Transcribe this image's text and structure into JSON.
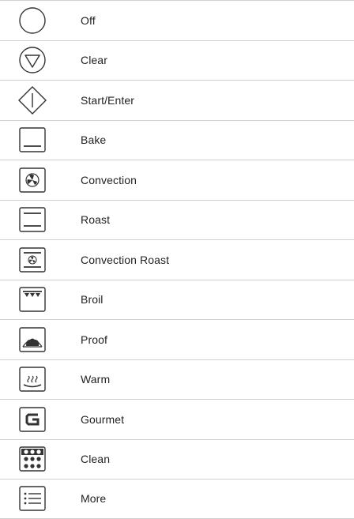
{
  "rows": [
    {
      "label": "Off",
      "icon": "off-circle-icon"
    },
    {
      "label": "Clear",
      "icon": "clear-triangle-icon"
    },
    {
      "label": "Start/Enter",
      "icon": "start-diamond-icon"
    },
    {
      "label": "Bake",
      "icon": "bake-icon"
    },
    {
      "label": "Convection",
      "icon": "convection-fan-icon"
    },
    {
      "label": "Roast",
      "icon": "roast-icon"
    },
    {
      "label": "Convection Roast",
      "icon": "convection-roast-icon"
    },
    {
      "label": "Broil",
      "icon": "broil-icon"
    },
    {
      "label": "Proof",
      "icon": "proof-bread-icon"
    },
    {
      "label": "Warm",
      "icon": "warm-steam-icon"
    },
    {
      "label": "Gourmet",
      "icon": "gourmet-g-icon"
    },
    {
      "label": "Clean",
      "icon": "clean-dots-icon"
    },
    {
      "label": "More",
      "icon": "more-list-icon"
    }
  ],
  "colors": {
    "divider": "#cfcfcf",
    "icon_stroke": "#333333",
    "text": "#222222"
  }
}
